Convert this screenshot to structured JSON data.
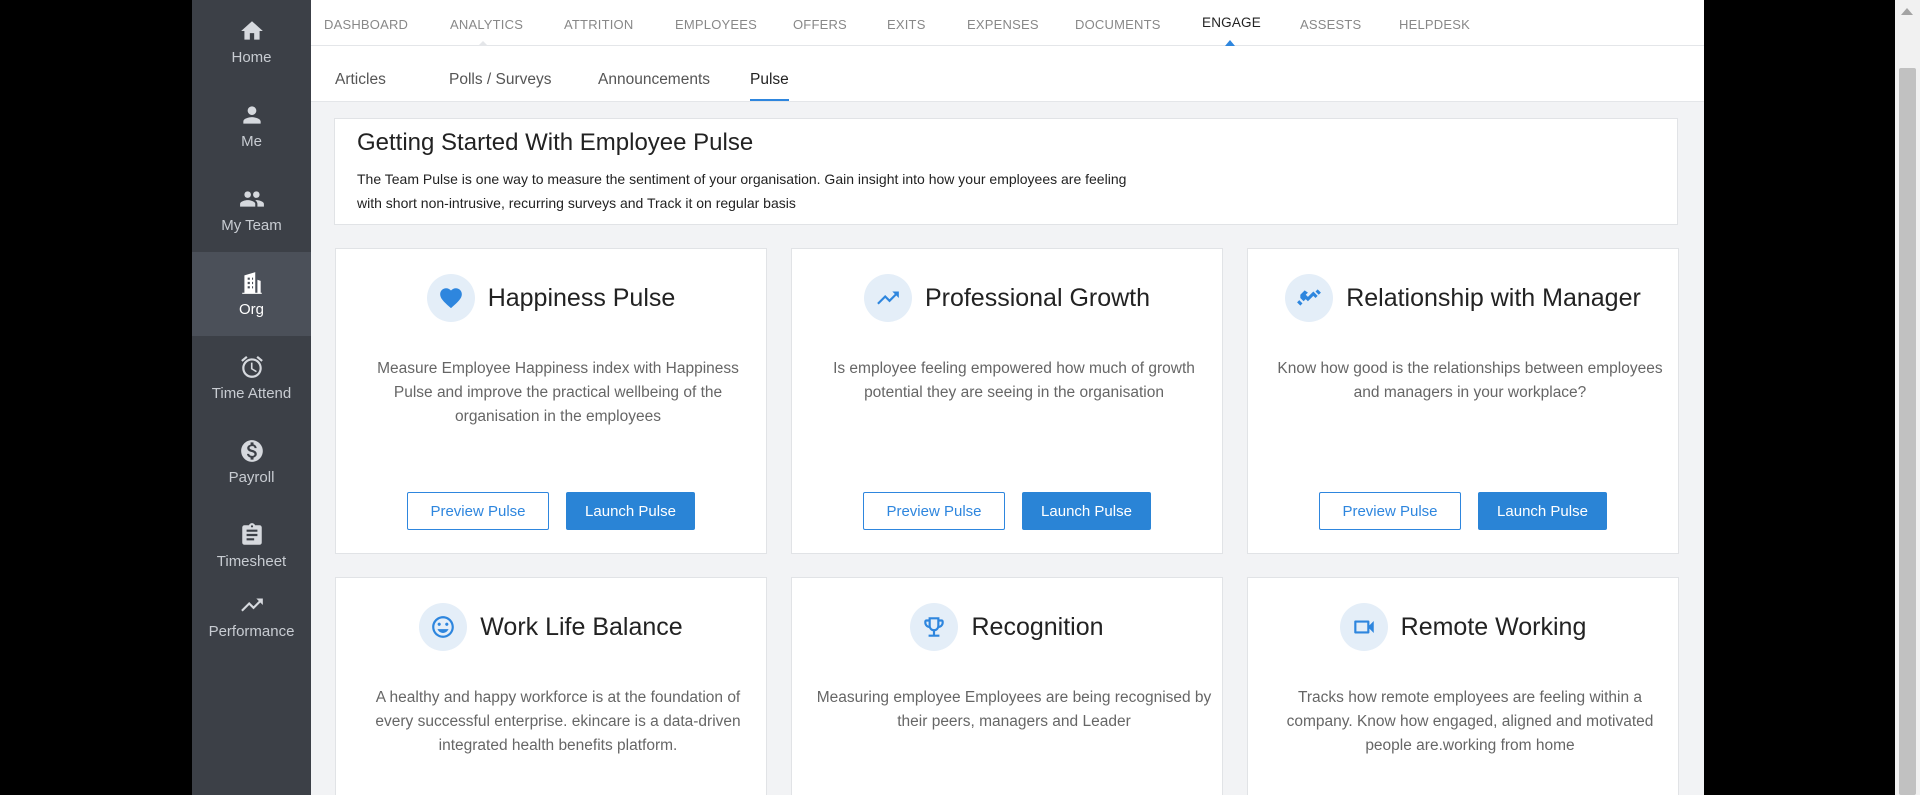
{
  "sidebar": {
    "items": [
      {
        "label": "Home",
        "icon": "home-icon"
      },
      {
        "label": "Me",
        "icon": "person-icon"
      },
      {
        "label": "My Team",
        "icon": "people-icon"
      },
      {
        "label": "Org",
        "icon": "building-icon",
        "active": true
      },
      {
        "label": "Time Attend",
        "icon": "alarm-clock-icon"
      },
      {
        "label": "Payroll",
        "icon": "dollar-icon"
      },
      {
        "label": "Timesheet",
        "icon": "clipboard-icon"
      },
      {
        "label": "Performance",
        "icon": "trending-up-icon"
      }
    ]
  },
  "topnav": {
    "items": [
      "DASHBOARD",
      "ANALYTICS",
      "ATTRITION",
      "EMPLOYEES",
      "OFFERS",
      "EXITS",
      "EXPENSES",
      "DOCUMENTS",
      "ENGAGE",
      "ASSESTS",
      "HELPDESK"
    ],
    "active": "ENGAGE"
  },
  "subnav": {
    "items": [
      "Articles",
      "Polls / Surveys",
      "Announcements",
      "Pulse"
    ],
    "active": "Pulse"
  },
  "intro": {
    "title": "Getting Started With Employee Pulse",
    "line1": "The Team Pulse is one way to measure the sentiment of your organisation. Gain insight into how your employees are feeling",
    "line2": "with short non-intrusive, recurring surveys and Track it on regular basis"
  },
  "cards": [
    {
      "title": "Happiness Pulse",
      "icon": "heart-icon",
      "desc": "Measure Employee Happiness index with Happiness Pulse and improve the  practical wellbeing of the organisation in the employees",
      "preview": "Preview Pulse",
      "launch": "Launch Pulse"
    },
    {
      "title": "Professional Growth",
      "icon": "trending-up-icon",
      "desc": "Is employee feeling empowered how  much of growth potential they are seeing in the organisation",
      "preview": "Preview Pulse",
      "launch": "Launch Pulse"
    },
    {
      "title": "Relationship with Manager",
      "icon": "handshake-icon",
      "desc": "Know how good is the relationships between employees and managers in your workplace?",
      "preview": "Preview Pulse",
      "launch": "Launch Pulse"
    },
    {
      "title": "Work Life Balance",
      "icon": "smiley-icon",
      "desc": "A healthy and happy workforce is at the foundation of every successful enterprise. ekincare is a data-driven integrated health benefits platform."
    },
    {
      "title": "Recognition",
      "icon": "trophy-icon",
      "desc": "Measuring employee Employees are being recognised by their peers, managers and Leader"
    },
    {
      "title": "Remote Working",
      "icon": "video-camera-icon",
      "desc": "Tracks how remote employees are feeling within a company.  Know how engaged, aligned and motivated people are.working from home"
    }
  ],
  "colors": {
    "accent": "#2e86de",
    "sidebar": "#3c4047",
    "background": "#f2f3f5"
  }
}
